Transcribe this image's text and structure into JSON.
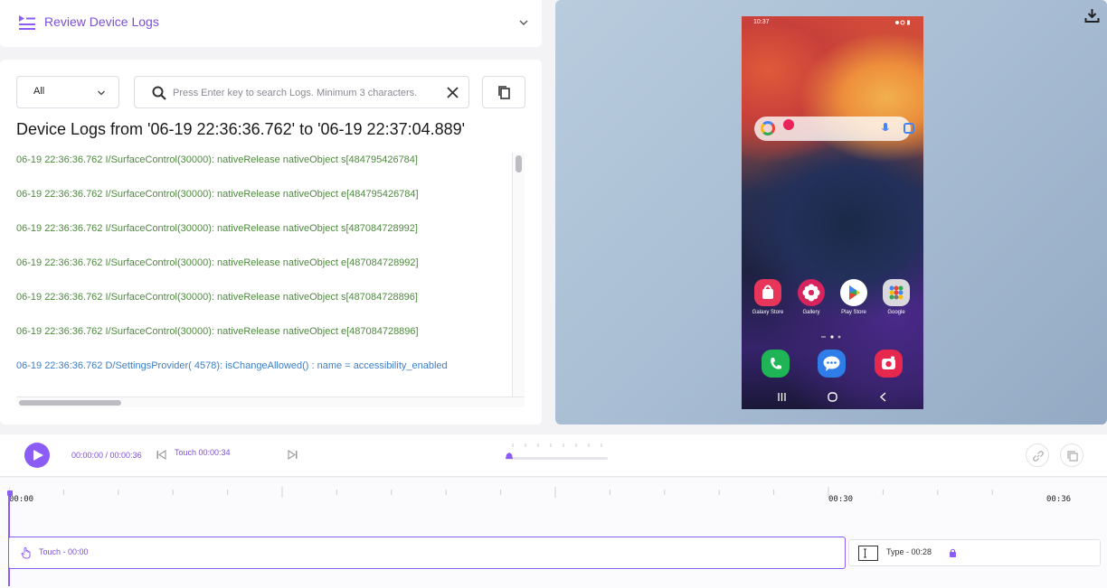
{
  "header": {
    "title": "Review Device Logs"
  },
  "filters": {
    "level_selected": "All",
    "search_placeholder": "Press Enter key to search Logs. Minimum 3 characters."
  },
  "logs": {
    "title": "Device Logs from '06-19 22:36:36.762' to '06-19 22:37:04.889'",
    "lines": [
      {
        "level": "info",
        "text": "06-19 22:36:36.762 I/SurfaceControl(30000): nativeRelease nativeObject s[484795426784]"
      },
      {
        "level": "info",
        "text": "06-19 22:36:36.762 I/SurfaceControl(30000): nativeRelease nativeObject e[484795426784]"
      },
      {
        "level": "info",
        "text": "06-19 22:36:36.762 I/SurfaceControl(30000): nativeRelease nativeObject s[487084728992]"
      },
      {
        "level": "info",
        "text": "06-19 22:36:36.762 I/SurfaceControl(30000): nativeRelease nativeObject e[487084728992]"
      },
      {
        "level": "info",
        "text": "06-19 22:36:36.762 I/SurfaceControl(30000): nativeRelease nativeObject s[487084728896]"
      },
      {
        "level": "info",
        "text": "06-19 22:36:36.762 I/SurfaceControl(30000): nativeRelease nativeObject e[487084728896]"
      },
      {
        "level": "debug",
        "text": "06-19 22:36:36.762 D/SettingsProvider( 4578): isChangeAllowed() : name = accessibility_enabled"
      }
    ]
  },
  "device": {
    "status_time": "10:37",
    "apps": [
      {
        "label": "Galaxy Store",
        "color": "#e8365a",
        "icon": "bag-icon"
      },
      {
        "label": "Gallery",
        "color": "#d6245e",
        "icon": "flower-icon"
      },
      {
        "label": "Play Store",
        "color": "#ffffff",
        "icon": "play-store-icon"
      },
      {
        "label": "Google",
        "color": "#d9d9dd",
        "icon": "google-folder-icon"
      }
    ],
    "dock": [
      {
        "name": "phone-icon",
        "color": "#1fb455"
      },
      {
        "name": "messages-icon",
        "color": "#2f7de8"
      },
      {
        "name": "camera-icon",
        "color": "#e6284f"
      }
    ]
  },
  "player": {
    "time": "00:00:00 / 00:00:36",
    "event_label": "Touch 00:00:34"
  },
  "timeline": {
    "labels": [
      {
        "text": "00:00",
        "sec": 0
      },
      {
        "text": "00:30",
        "sec": 30
      },
      {
        "text": "00:36",
        "sec": 36
      }
    ],
    "duration_sec": 36,
    "segments": {
      "touch": "Touch - 00:00",
      "type": "Type - 00:28"
    }
  },
  "colors": {
    "accent": "#8b5cf6",
    "log_info": "#4e8a3e",
    "log_debug": "#3d7fc6"
  }
}
